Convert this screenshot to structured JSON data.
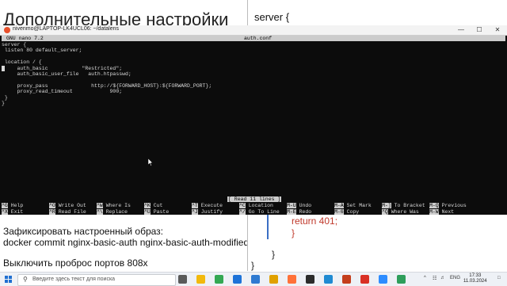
{
  "slide": {
    "title": "Дополнительные настройки",
    "line1": "Зафиксировать настроенный образ:",
    "line2": "docker commit nginx-basic-auth nginx-basic-auth-modified",
    "line3": "Выключить проброс портов 808x"
  },
  "code_panel": {
    "top_line": "server {",
    "return_line": "return 401;",
    "close1": "}",
    "close2": "}",
    "close3": "}"
  },
  "terminal": {
    "window_title": "nivenmo@LAPTOP-LK4UCL06: ~/datalens",
    "min_label": "—",
    "max_label": "☐",
    "close_label": "✕",
    "nano_version": "GNU nano 7.2",
    "file_name": "auth.conf",
    "lines": [
      "server {",
      " listen 80 default_server;",
      "",
      " location / {",
      "     auth_basic           \"Restricted\";",
      "     auth_basic_user_file   auth.htpasswd;",
      "",
      "     proxy_pass              http://${FORWARD_HOST}:${FORWARD_PORT};",
      "     proxy_read_timeout            900;",
      " }",
      "}"
    ],
    "status_message": "[ Read 11 lines ]",
    "shortcuts_row1": [
      {
        "key": "^G",
        "label": "Help"
      },
      {
        "key": "^O",
        "label": "Write Out"
      },
      {
        "key": "^W",
        "label": "Where Is"
      },
      {
        "key": "^K",
        "label": "Cut"
      },
      {
        "key": "^T",
        "label": "Execute"
      },
      {
        "key": "^C",
        "label": "Location"
      },
      {
        "key": "M-U",
        "label": "Undo"
      },
      {
        "key": "M-A",
        "label": "Set Mark"
      },
      {
        "key": "M-]",
        "label": "To Bracket"
      },
      {
        "key": "M-Q",
        "label": "Previous"
      }
    ],
    "shortcuts_row2": [
      {
        "key": "^X",
        "label": "Exit"
      },
      {
        "key": "^R",
        "label": "Read File"
      },
      {
        "key": "^\\",
        "label": "Replace"
      },
      {
        "key": "^U",
        "label": "Paste"
      },
      {
        "key": "^J",
        "label": "Justify"
      },
      {
        "key": "^/",
        "label": "Go To Line"
      },
      {
        "key": "M-E",
        "label": "Redo"
      },
      {
        "key": "M-6",
        "label": "Copy"
      },
      {
        "key": "^Q",
        "label": "Where Was"
      },
      {
        "key": "M-W",
        "label": "Next"
      }
    ]
  },
  "taskbar": {
    "search_placeholder": "Введите здесь текст для поиска",
    "language": "ENG",
    "time": "17:33",
    "date": "11.03.2024",
    "apps": [
      {
        "name": "task-view-icon",
        "color": "#5a5a5a"
      },
      {
        "name": "explorer-icon",
        "color": "#f2b90d"
      },
      {
        "name": "chrome-icon",
        "color": "#34a853"
      },
      {
        "name": "mail-icon",
        "color": "#1e73d8"
      },
      {
        "name": "store-icon",
        "color": "#2f7ad1"
      },
      {
        "name": "app-y-icon",
        "color": "#e0a100"
      },
      {
        "name": "firefox-icon",
        "color": "#ff7139"
      },
      {
        "name": "terminal-app-icon",
        "color": "#2b2b2b"
      },
      {
        "name": "vscode-icon",
        "color": "#1f8ad2"
      },
      {
        "name": "powerpoint-icon",
        "color": "#c43e1c"
      },
      {
        "name": "app-red-icon",
        "color": "#d93025"
      },
      {
        "name": "zoom-icon",
        "color": "#2d8cff"
      },
      {
        "name": "app-green-icon",
        "color": "#2e9e5b"
      }
    ]
  }
}
